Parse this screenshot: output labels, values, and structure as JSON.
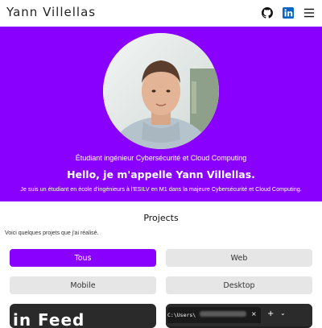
{
  "header": {
    "brand": "Yann Villellas",
    "icons": [
      "github-icon",
      "linkedin-icon",
      "menu-icon"
    ]
  },
  "hero": {
    "subtitle": "Étudiant ingénieur Cybersécurité et Cloud Computing",
    "title": "Hello, je m'appelle Yann Villellas.",
    "description": "Je suis un étudiant en école d'ingénieurs à l'ESILV en M1 dans la majeure Cybersécurité et Cloud Computing.",
    "background_color": "#8a00ff"
  },
  "projects": {
    "title": "Projects",
    "intro": "Voici quelques projets que j'ai réalisé.",
    "filters": [
      {
        "label": "Tous",
        "active": true
      },
      {
        "label": "Web",
        "active": false
      },
      {
        "label": "Mobile",
        "active": false
      },
      {
        "label": "Desktop",
        "active": false
      }
    ],
    "cards": [
      {
        "visible_text": "in Feed"
      },
      {
        "visible_text": "C:\\Users\\",
        "close": "×",
        "plus": "+",
        "chevron": "⌄"
      }
    ]
  },
  "colors": {
    "accent": "#8a00ff",
    "inactive": "#e6e6e6"
  }
}
